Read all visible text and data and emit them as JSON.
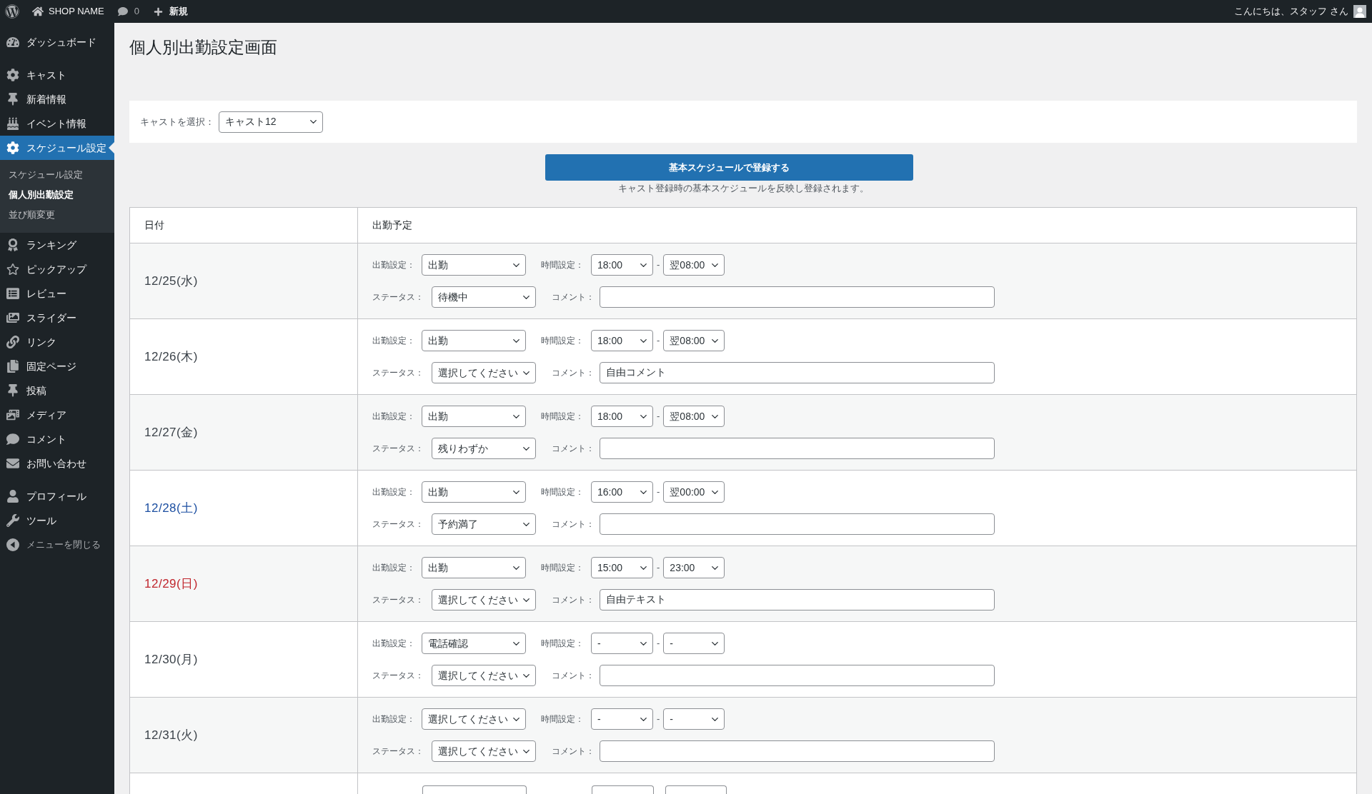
{
  "admin_bar": {
    "site_name": "SHOP NAME",
    "comment_count": "0",
    "new_label": "新規",
    "greeting": "こんにちは、スタッフ さん"
  },
  "sidebar": {
    "groups": [
      {
        "items": [
          {
            "label": "ダッシュボード",
            "selected": false
          }
        ]
      },
      {
        "items": [
          {
            "label": "キャスト",
            "selected": false
          },
          {
            "label": "新着情報",
            "selected": false
          },
          {
            "label": "イベント情報",
            "selected": false
          },
          {
            "label": "スケジュール設定",
            "selected": true,
            "children": [
              {
                "label": "スケジュール設定",
                "selected": false
              },
              {
                "label": "個人別出勤設定",
                "selected": true
              },
              {
                "label": "並び順変更",
                "selected": false
              }
            ]
          },
          {
            "label": "ランキング",
            "selected": false
          },
          {
            "label": "ピックアップ",
            "selected": false
          },
          {
            "label": "レビュー",
            "selected": false
          },
          {
            "label": "スライダー",
            "selected": false
          },
          {
            "label": "リンク",
            "selected": false
          },
          {
            "label": "固定ページ",
            "selected": false
          },
          {
            "label": "投稿",
            "selected": false
          },
          {
            "label": "メディア",
            "selected": false
          },
          {
            "label": "コメント",
            "selected": false
          },
          {
            "label": "お問い合わせ",
            "selected": false
          }
        ]
      },
      {
        "items": [
          {
            "label": "プロフィール",
            "selected": false
          },
          {
            "label": "ツール",
            "selected": false
          }
        ]
      }
    ],
    "collapse_label": "メニューを閉じる"
  },
  "page": {
    "title": "個人別出勤設定画面"
  },
  "cast_selector": {
    "label": "キャストを選択：",
    "value": "キャスト12"
  },
  "register_button": {
    "label": "基本スケジュールで登録する",
    "hint": "キャスト登録時の基本スケジュールを反映し登録されます。"
  },
  "table": {
    "columns": [
      "日付",
      "出勤予定"
    ],
    "rows": [
      {
        "date": "12/25(水)",
        "color": "#3c434a",
        "attendance_label": "出勤設定：",
        "attendance": "出勤",
        "time_label": "時間設定：",
        "start": "18:00",
        "time_separator": "-",
        "end": "翌08:00",
        "status_label": "ステータス：",
        "status": "待機中",
        "comment_label": "コメント："
      },
      {
        "date": "12/26(木)",
        "color": "#3c434a",
        "attendance_label": "出勤設定：",
        "attendance": "出勤",
        "time_label": "時間設定：",
        "start": "18:00",
        "time_separator": "-",
        "end": "翌08:00",
        "status_label": "ステータス：",
        "status": "選択してください",
        "comment_label": "コメント：",
        "comment": "自由コメント"
      },
      {
        "date": "12/27(金)",
        "color": "#3c434a",
        "attendance_label": "出勤設定：",
        "attendance": "出勤",
        "time_label": "時間設定：",
        "start": "18:00",
        "time_separator": "-",
        "end": "翌08:00",
        "status_label": "ステータス：",
        "status": "残りわずか",
        "comment_label": "コメント："
      },
      {
        "date": "12/28(土)",
        "color": "#1e50a2",
        "attendance_label": "出勤設定：",
        "attendance": "出勤",
        "time_label": "時間設定：",
        "start": "16:00",
        "time_separator": "-",
        "end": "翌00:00",
        "status_label": "ステータス：",
        "status": "予約満了",
        "comment_label": "コメント："
      },
      {
        "date": "12/29(日)",
        "color": "#c0262d",
        "attendance_label": "出勤設定：",
        "attendance": "出勤",
        "time_label": "時間設定：",
        "start": "15:00",
        "time_separator": "-",
        "end": "23:00",
        "status_label": "ステータス：",
        "status": "選択してください",
        "comment_label": "コメント：",
        "comment": "自由テキスト"
      },
      {
        "date": "12/30(月)",
        "color": "#3c434a",
        "attendance_label": "出勤設定：",
        "attendance": "電話確認",
        "time_label": "時間設定：",
        "start": "-",
        "time_separator": "-",
        "end": "-",
        "status_label": "ステータス：",
        "status": "選択してください",
        "comment_label": "コメント："
      },
      {
        "date": "12/31(火)",
        "color": "#3c434a",
        "attendance_label": "出勤設定：",
        "attendance": "選択してください",
        "time_label": "時間設定：",
        "start": "-",
        "time_separator": "-",
        "end": "-",
        "status_label": "ステータス：",
        "status": "選択してください",
        "comment_label": "コメント："
      }
    ]
  }
}
